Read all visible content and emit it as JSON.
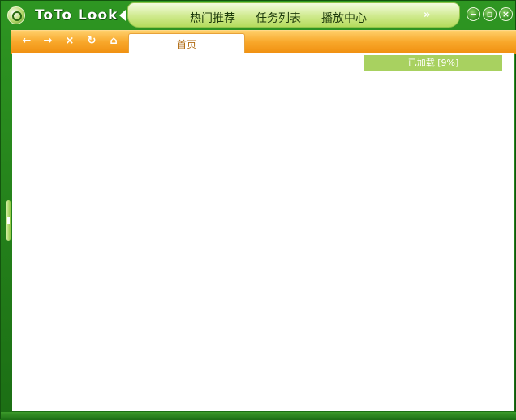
{
  "app": {
    "logo_text": "ToTo Look"
  },
  "nav": {
    "items": [
      "热门推荐",
      "任务列表",
      "播放中心"
    ],
    "more": "»"
  },
  "window_controls": {
    "minimize": "−",
    "maximize": "▫",
    "close": "×"
  },
  "toolbar": {
    "back": "←",
    "forward": "→",
    "stop": "×",
    "refresh": "↻",
    "home": "⌂"
  },
  "tabs": [
    {
      "label": "首页"
    }
  ],
  "status": {
    "loading_text": "已加载 [9%]",
    "progress_percent": 9
  },
  "colors": {
    "frame": "#2e9622",
    "toolbar": "#f8a72a",
    "accent": "#a8d160",
    "tab_text": "#b06a10"
  }
}
